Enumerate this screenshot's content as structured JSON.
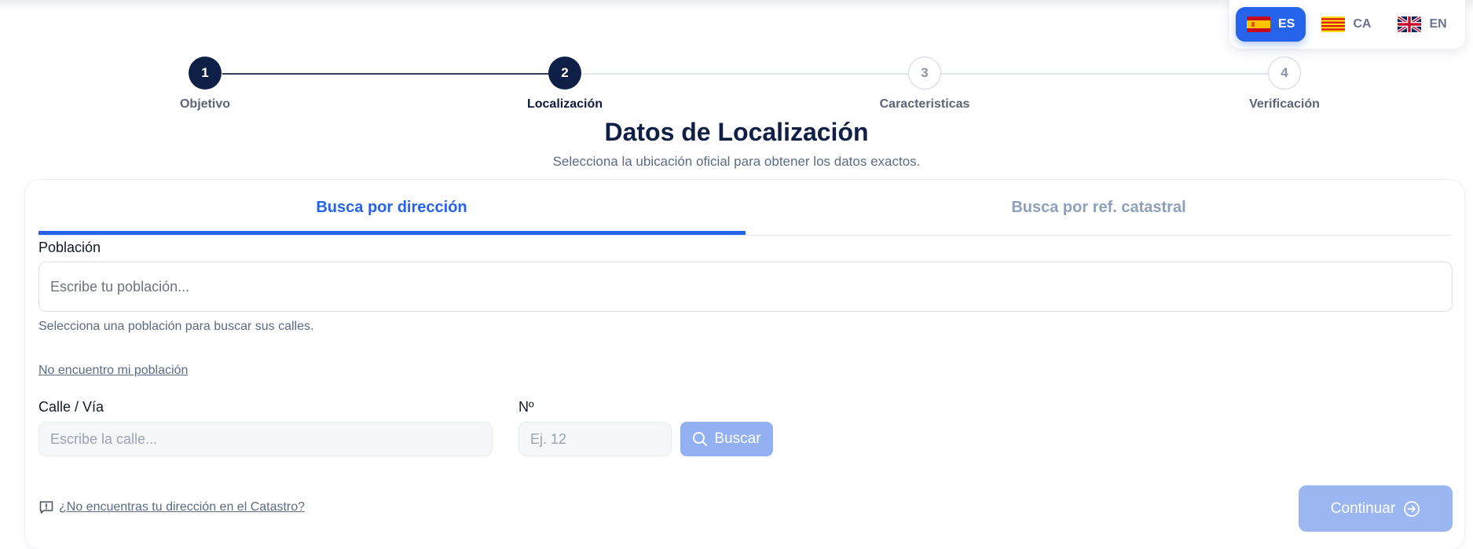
{
  "language_switcher": {
    "languages": [
      {
        "code": "ES",
        "flag": "spain-flag-icon",
        "active": true
      },
      {
        "code": "CA",
        "flag": "catalonia-flag-icon",
        "active": false
      },
      {
        "code": "EN",
        "flag": "uk-flag-icon",
        "active": false
      }
    ],
    "accent_color": "#2563eb"
  },
  "stepper": {
    "current_step": 2,
    "steps": [
      {
        "number": "1",
        "label": "Objetivo",
        "state": "completed"
      },
      {
        "number": "2",
        "label": "Localización",
        "state": "current"
      },
      {
        "number": "3",
        "label": "Caracteristicas",
        "state": "upcoming"
      },
      {
        "number": "4",
        "label": "Verificación",
        "state": "upcoming"
      }
    ]
  },
  "header": {
    "title": "Datos de Localización",
    "subtitle": "Selecciona la ubicación oficial para obtener los datos exactos."
  },
  "tabs": [
    {
      "label": "Busca por dirección",
      "active": true
    },
    {
      "label": "Busca por ref. catastral",
      "active": false
    }
  ],
  "form": {
    "poblacion": {
      "label": "Población",
      "placeholder": "Escribe tu población...",
      "value": "",
      "helper": "Selecciona una población para buscar sus calles."
    },
    "not_found_town_link": "No encuentro mi población",
    "calle": {
      "label": "Calle / Vía",
      "placeholder": "Escribe la calle...",
      "value": ""
    },
    "numero": {
      "label": "Nº",
      "placeholder": "Ej. 12",
      "value": ""
    },
    "search_button": {
      "label": "Buscar",
      "icon": "search-icon"
    }
  },
  "footer": {
    "catastro_help_icon": "message-alert-icon",
    "catastro_help_link": "¿No encuentras tu dirección en el Catastro?",
    "continue_button": {
      "label": "Continuar",
      "icon": "arrow-right-circle-icon"
    }
  },
  "colors": {
    "primary": "#2563eb",
    "navy": "#0f1f45",
    "disabled_button": "#9bb6f0"
  }
}
